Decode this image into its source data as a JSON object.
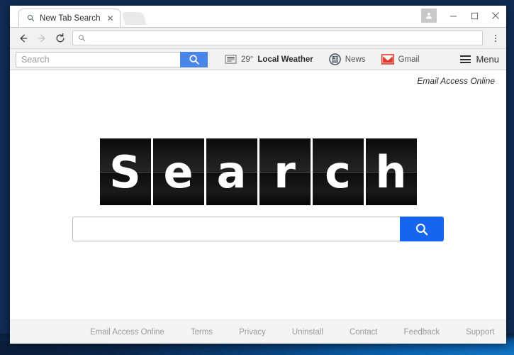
{
  "window": {
    "controls": {
      "profile": "profile-icon",
      "minimize": "–",
      "maximize": "□",
      "close": "✕"
    }
  },
  "tabstrip": {
    "tab": {
      "title": "New Tab Search",
      "favicon": "search-icon",
      "close_label": "✕"
    },
    "new_tab_label": "+"
  },
  "navbar": {
    "back_label": "←",
    "forward_label": "→",
    "reload_label": "⟳",
    "omnibox": {
      "value": "",
      "placeholder": "",
      "icon": "search-icon"
    },
    "menu_label": "⋮"
  },
  "exttoolbar": {
    "search": {
      "value": "",
      "placeholder": "Search",
      "button_icon": "search-icon",
      "button_color": "#4a86e8"
    },
    "links": [
      {
        "name": "weather",
        "icon": "weather-icon",
        "temp": "29°",
        "label": "Local Weather"
      },
      {
        "name": "news",
        "icon": "news-icon",
        "temp": "",
        "label": "News"
      },
      {
        "name": "gmail",
        "icon": "gmail-icon",
        "temp": "",
        "label": "Gmail"
      }
    ],
    "menu": {
      "icon": "hamburger-icon",
      "label": "Menu"
    }
  },
  "page": {
    "top_link": "Email Access Online",
    "logo_letters": [
      "S",
      "e",
      "a",
      "r",
      "c",
      "h"
    ],
    "search": {
      "value": "",
      "placeholder": "",
      "button_icon": "search-icon",
      "button_color": "#1565f0"
    },
    "footer_links": [
      "Email Access Online",
      "Terms",
      "Privacy",
      "Uninstall",
      "Contact",
      "Feedback",
      "Support"
    ]
  },
  "colors": {
    "desktop": "#102a52",
    "toolbar_bg": "#f2f2f2",
    "accent_blue": "#1565f0",
    "gmail_red": "#e03a2f"
  }
}
